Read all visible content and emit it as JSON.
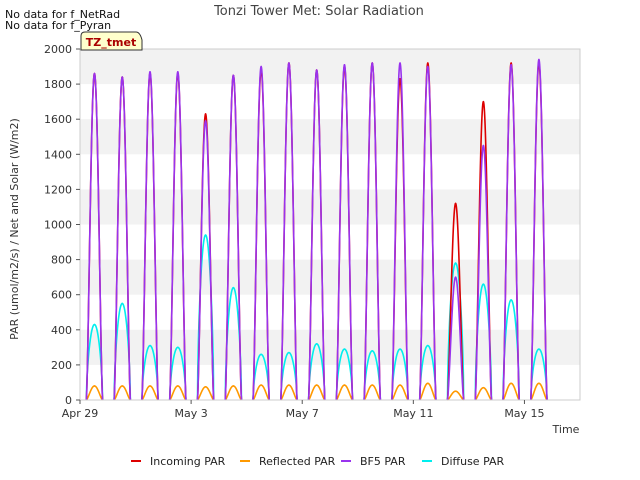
{
  "notes": [
    "No data for f_NetRad",
    "No data for f_Pyran"
  ],
  "chart_data": {
    "type": "line",
    "title": "Tonzi Tower Met: Solar Radiation",
    "xlabel": "Time",
    "ylabel": "PAR (umol/m2/s) / Net and Solar (W/m2)",
    "ylim": [
      0,
      2000
    ],
    "yticks": [
      0,
      200,
      400,
      600,
      800,
      1000,
      1200,
      1400,
      1600,
      1800,
      2000
    ],
    "xlim": [
      "2024-04-29",
      "2024-05-17"
    ],
    "xticks": [
      {
        "date": "2024-04-29",
        "label": "Apr 29"
      },
      {
        "date": "2024-05-03",
        "label": "May 3"
      },
      {
        "date": "2024-05-07",
        "label": "May 7"
      },
      {
        "date": "2024-05-11",
        "label": "May 11"
      },
      {
        "date": "2024-05-15",
        "label": "May 15"
      }
    ],
    "grid": "horizontal bands",
    "legend_position": "bottom",
    "site_tag": "TZ_tmet",
    "x": [
      "2024-04-29",
      "2024-04-30",
      "2024-05-01",
      "2024-05-02",
      "2024-05-03",
      "2024-05-04",
      "2024-05-05",
      "2024-05-06",
      "2024-05-07",
      "2024-05-08",
      "2024-05-09",
      "2024-05-10",
      "2024-05-11",
      "2024-05-12",
      "2024-05-13",
      "2024-05-14",
      "2024-05-15",
      "2024-05-16"
    ],
    "x_note": "daily midday peak values",
    "series": [
      {
        "name": "Incoming PAR",
        "color": "#dd0000",
        "values": [
          1860,
          1840,
          1860,
          1860,
          1630,
          1850,
          1880,
          1920,
          1880,
          1900,
          1920,
          1830,
          1920,
          1120,
          1700,
          1920,
          1920,
          0
        ]
      },
      {
        "name": "Reflected PAR",
        "color": "#ff9900",
        "values": [
          80,
          80,
          80,
          80,
          75,
          80,
          85,
          85,
          85,
          85,
          85,
          85,
          95,
          50,
          70,
          95,
          95,
          0
        ]
      },
      {
        "name": "BF5 PAR",
        "color": "#9933ee",
        "values": [
          1860,
          1840,
          1870,
          1870,
          1590,
          1850,
          1900,
          1920,
          1880,
          1910,
          1920,
          1920,
          1900,
          700,
          1450,
          1910,
          1940,
          0
        ]
      },
      {
        "name": "Diffuse PAR",
        "color": "#00eeee",
        "values": [
          430,
          550,
          310,
          300,
          940,
          640,
          260,
          270,
          320,
          290,
          280,
          290,
          310,
          780,
          660,
          570,
          290,
          0
        ]
      }
    ]
  }
}
